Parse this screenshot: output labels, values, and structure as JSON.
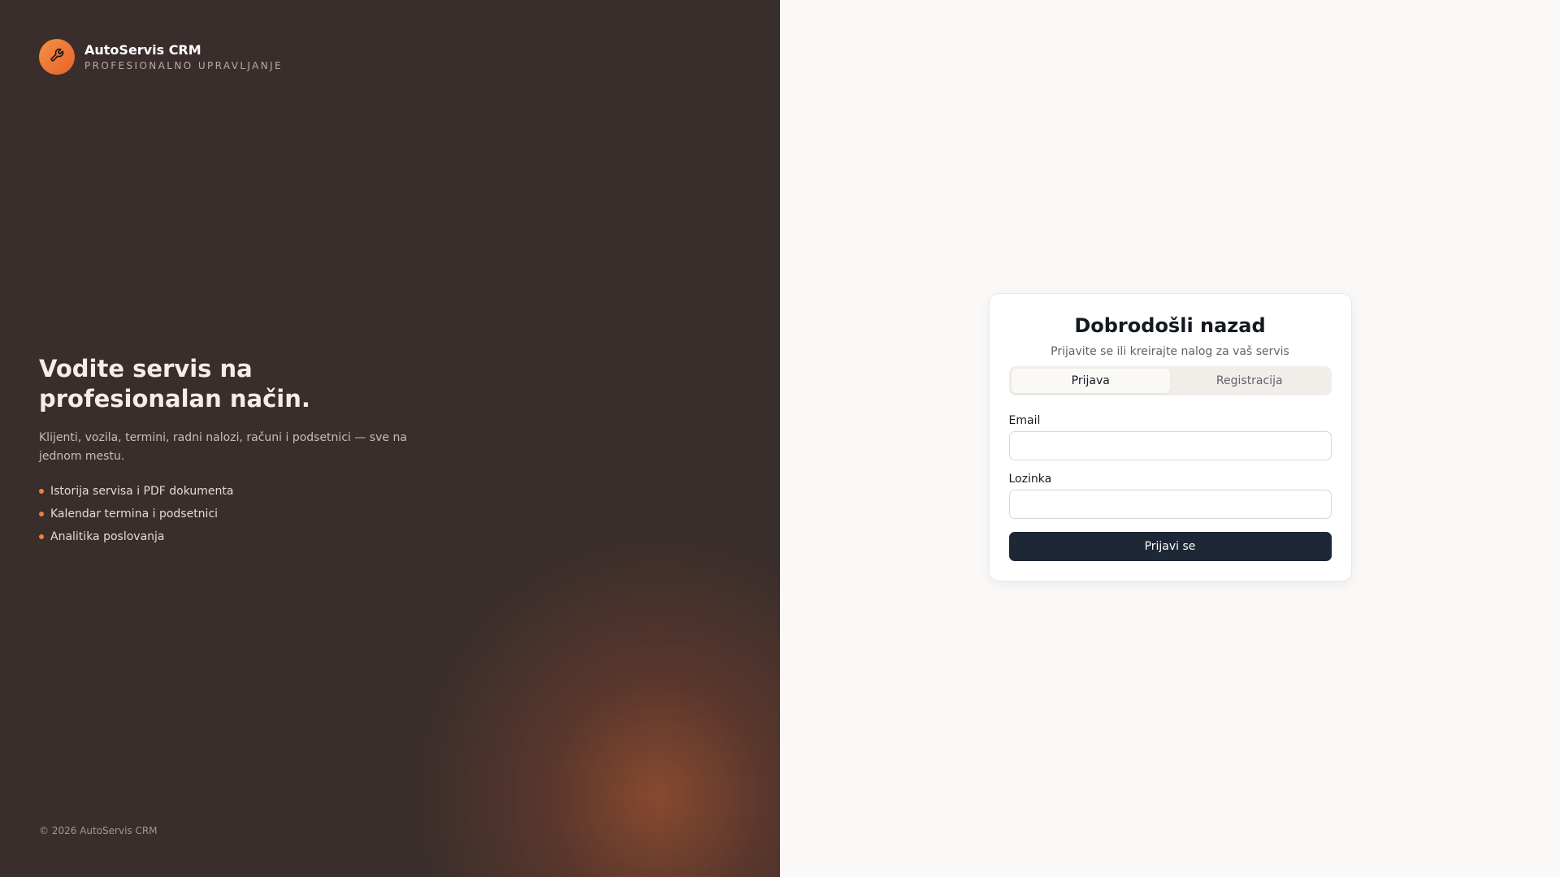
{
  "brand": {
    "name": "AutoServis CRM",
    "subtitle": "PROFESIONALNO UPRAVLJANJE",
    "logo_icon": "wrench-icon",
    "accent": "#f07e36"
  },
  "hero": {
    "title": "Vodite servis na profesionalan način.",
    "description": "Klijenti, vozila, termini, radni nalozi, računi i podsetnici — sve na jednom mestu.",
    "features": [
      "Istorija servisa i PDF dokumenta",
      "Kalendar termina i podsetnici",
      "Analitika poslovanja"
    ]
  },
  "footer": {
    "copyright": "© 2026 AutoServis CRM"
  },
  "auth": {
    "title": "Dobrodošli nazad",
    "subtitle": "Prijavite se ili kreirajte nalog za vaš servis",
    "tabs": [
      {
        "label": "Prijava",
        "active": true
      },
      {
        "label": "Registracija",
        "active": false
      }
    ],
    "email_label": "Email",
    "email_value": "",
    "password_label": "Lozinka",
    "password_value": "",
    "submit_label": "Prijavi se",
    "button_color": "#1d2735"
  }
}
